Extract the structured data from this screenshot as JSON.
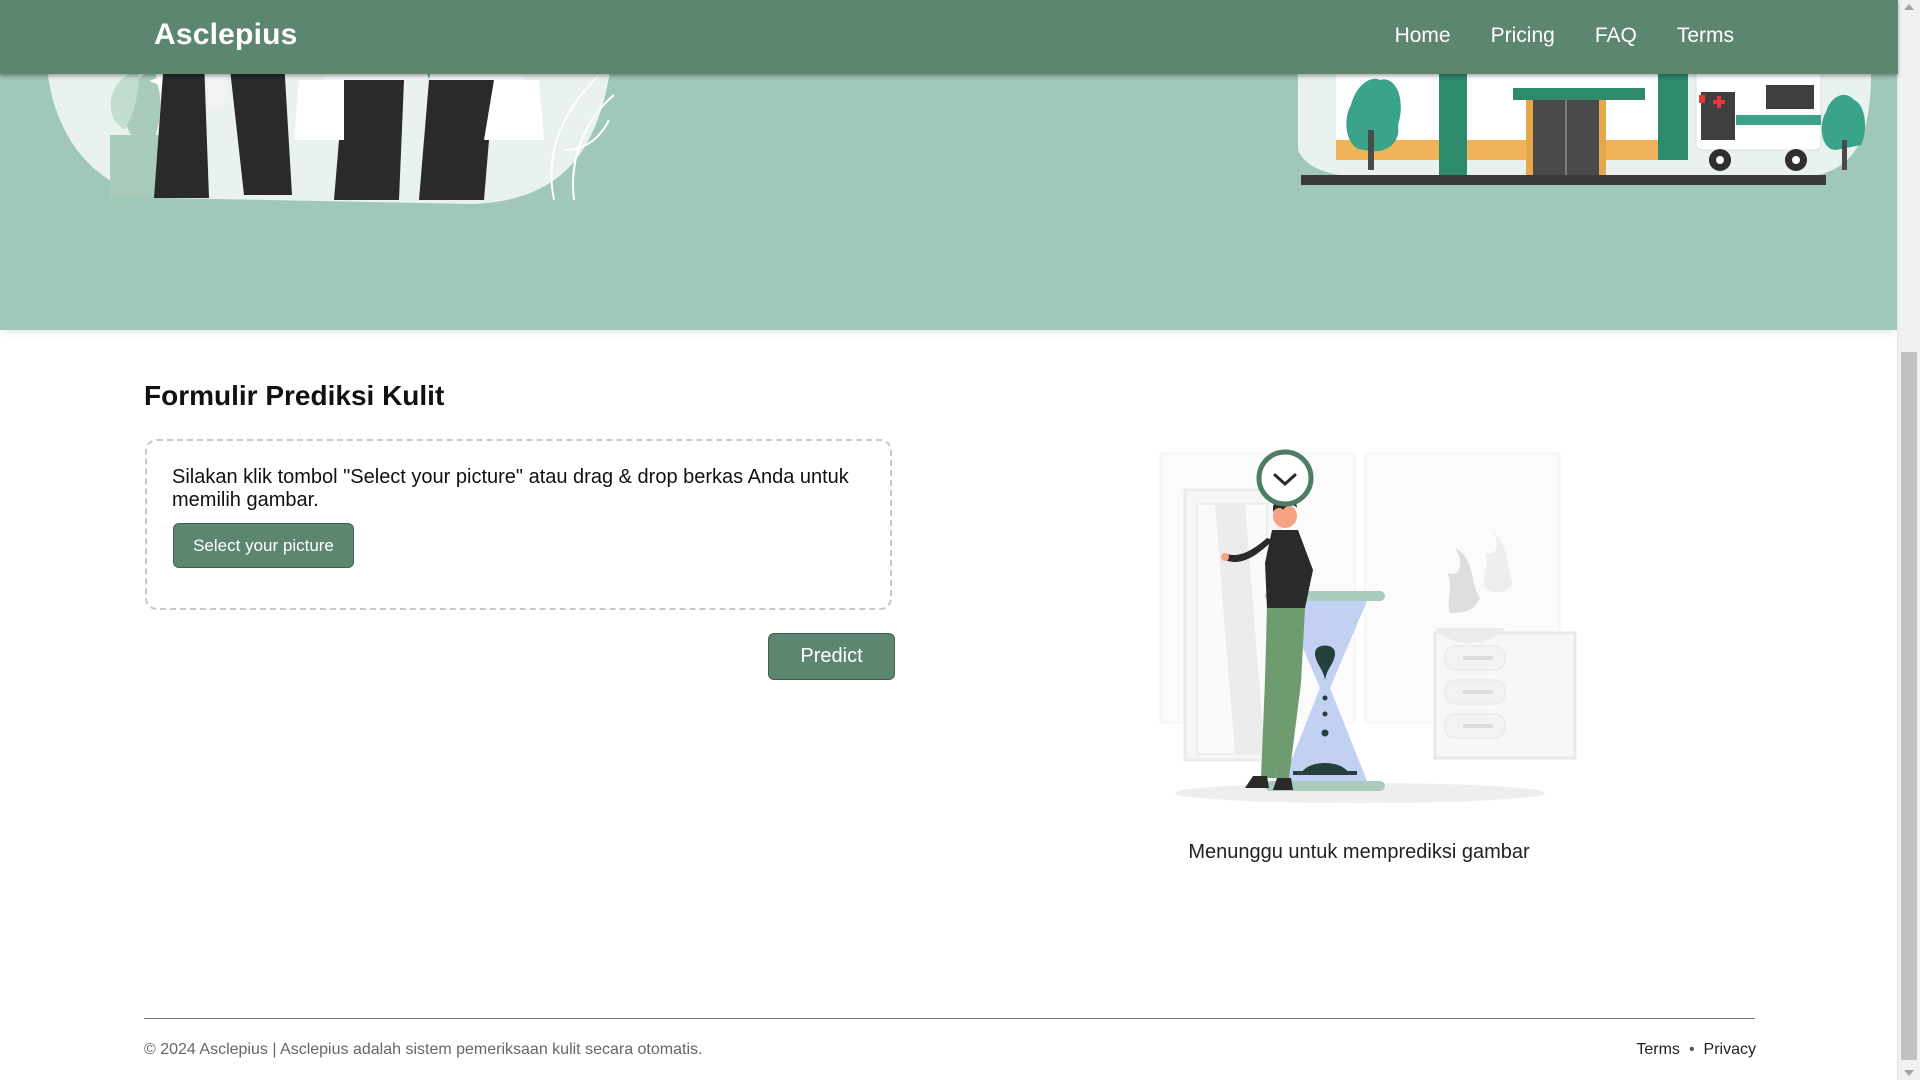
{
  "navbar": {
    "brand": "Asclepius",
    "links": [
      "Home",
      "Pricing",
      "FAQ",
      "Terms"
    ]
  },
  "hero": {
    "left_illustration": "doctors-illustration",
    "right_illustration": "hospital-ambulance-illustration"
  },
  "form": {
    "title": "Formulir Prediksi Kulit",
    "instruction": "Silakan klik tombol \"Select your picture\" atau drag & drop berkas Anda untuk memilih gambar.",
    "select_button": "Select your picture",
    "predict_button": "Predict"
  },
  "result": {
    "illustration": "waiting-hourglass-illustration",
    "status": "Menunggu untuk memprediksi gambar"
  },
  "footer": {
    "copyright": "© 2024 Asclepius | Asclepius adalah sistem pemeriksaan kulit secara otomatis.",
    "links": [
      "Terms",
      "Privacy"
    ],
    "separator": "•"
  },
  "colors": {
    "primary": "#5c866f",
    "hero_bg": "#9fc8b9",
    "dark": "#2c2c2c"
  }
}
